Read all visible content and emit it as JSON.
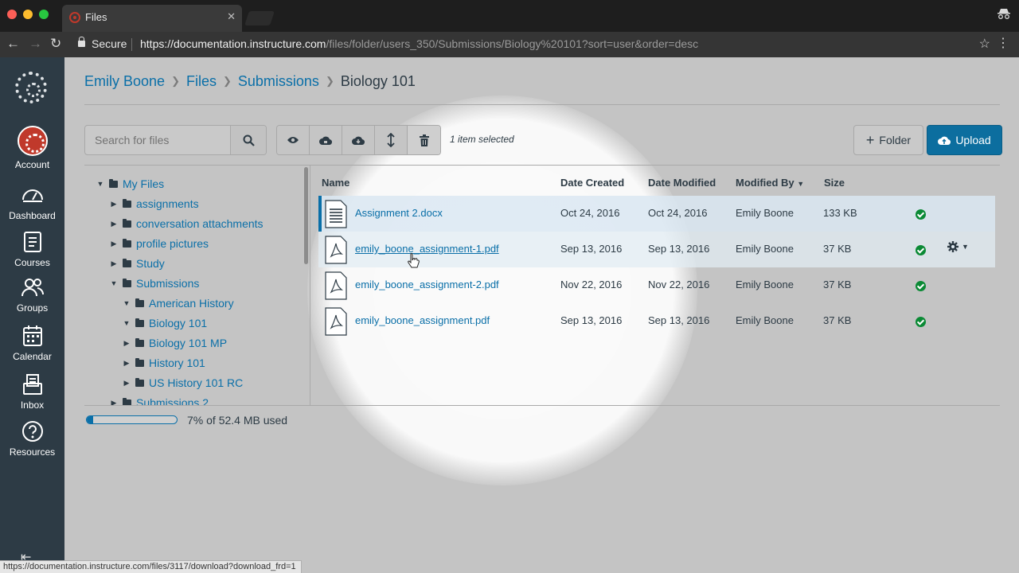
{
  "browser": {
    "tab_title": "Files",
    "tab_close": "✕",
    "secure_label": "Secure",
    "url_host": "https://documentation.instructure.com",
    "url_path": "/files/folder/users_350/Submissions/Biology%20101?sort=user&order=desc",
    "status_url": "https://documentation.instructure.com/files/3117/download?download_frd=1"
  },
  "global_nav": {
    "items": [
      {
        "label": "Account",
        "icon": "account-avatar"
      },
      {
        "label": "Dashboard",
        "icon": "dashboard-icon"
      },
      {
        "label": "Courses",
        "icon": "courses-icon"
      },
      {
        "label": "Groups",
        "icon": "groups-icon"
      },
      {
        "label": "Calendar",
        "icon": "calendar-icon"
      },
      {
        "label": "Inbox",
        "icon": "inbox-icon"
      },
      {
        "label": "Resources",
        "icon": "help-icon"
      }
    ]
  },
  "breadcrumb": [
    "Emily Boone",
    "Files",
    "Submissions",
    "Biology 101"
  ],
  "search": {
    "placeholder": "Search for files"
  },
  "toolbar": {
    "selection_text": "1 item selected",
    "actions": [
      "preview-icon",
      "restrict-access-icon",
      "download-icon",
      "move-icon",
      "delete-icon"
    ],
    "folder_label": "Folder",
    "upload_label": "Upload"
  },
  "tree": {
    "items": [
      {
        "label": "My Files",
        "expanded": true
      },
      {
        "label": "assignments",
        "expanded": false
      },
      {
        "label": "conversation attachments",
        "expanded": false
      },
      {
        "label": "profile pictures",
        "expanded": false
      },
      {
        "label": "Study",
        "expanded": false
      },
      {
        "label": "Submissions",
        "expanded": true
      },
      {
        "label": "American History",
        "expanded": true
      },
      {
        "label": "Biology 101",
        "expanded": true
      },
      {
        "label": "Biology 101 MP",
        "expanded": false
      },
      {
        "label": "History 101",
        "expanded": false
      },
      {
        "label": "US History 101 RC",
        "expanded": false
      },
      {
        "label": "Submissions 2",
        "expanded": false
      }
    ]
  },
  "table": {
    "columns": [
      "Name",
      "Date Created",
      "Date Modified",
      "Modified By",
      "Size"
    ],
    "sort_indicator": "▼",
    "rows": [
      {
        "name": "Assignment 2.docx",
        "created": "Oct 24, 2016",
        "modified": "Oct 24, 2016",
        "modified_by": "Emily Boone",
        "size": "133 KB",
        "type": "document",
        "selected": true
      },
      {
        "name": "emily_boone_assignment-1.pdf",
        "created": "Sep 13, 2016",
        "modified": "Sep 13, 2016",
        "modified_by": "Emily Boone",
        "size": "37 KB",
        "type": "pdf",
        "hovered": true
      },
      {
        "name": "emily_boone_assignment-2.pdf",
        "created": "Nov 22, 2016",
        "modified": "Nov 22, 2016",
        "modified_by": "Emily Boone",
        "size": "37 KB",
        "type": "pdf"
      },
      {
        "name": "emily_boone_assignment.pdf",
        "created": "Sep 13, 2016",
        "modified": "Sep 13, 2016",
        "modified_by": "Emily Boone",
        "size": "37 KB",
        "type": "pdf"
      }
    ]
  },
  "quota": {
    "text": "7% of 52.4 MB used",
    "fraction": 0.07
  },
  "colors": {
    "link": "#0a6fa8",
    "nav_bg": "#2d3b45",
    "upload": "#0c6e9f",
    "published": "#0b8a35"
  }
}
